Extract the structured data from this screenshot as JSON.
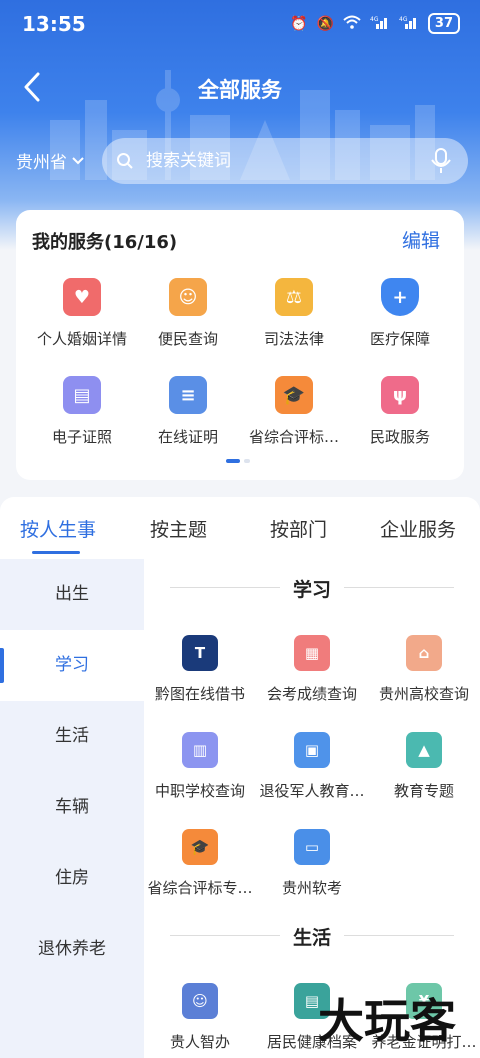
{
  "status": {
    "time": "13:55",
    "battery": "37",
    "icons": [
      "alarm-icon",
      "mute-icon",
      "wifi-icon",
      "signal-4g-icon",
      "signal-4g-icon"
    ]
  },
  "nav": {
    "title": "全部服务"
  },
  "location": {
    "province": "贵州省"
  },
  "search": {
    "placeholder": "搜索关键词"
  },
  "my_services": {
    "title": "我的服务(16/16)",
    "edit": "编辑",
    "items": [
      {
        "label": "个人婚姻详情",
        "icon": "marriage-icon",
        "color": "#f06b6b"
      },
      {
        "label": "便民查询",
        "icon": "house-smile-icon",
        "color": "#f5a54a"
      },
      {
        "label": "司法法律",
        "icon": "gavel-icon",
        "color": "#f4b63e"
      },
      {
        "label": "医疗保障",
        "icon": "shield-plus-icon",
        "color": "#3f86f0"
      },
      {
        "label": "电子证照",
        "icon": "id-card-icon",
        "color": "#8e8ff0"
      },
      {
        "label": "在线证明",
        "icon": "document-icon",
        "color": "#5a8fe6"
      },
      {
        "label": "省综合评标…",
        "icon": "graduate-icon",
        "color": "#f58a3a"
      },
      {
        "label": "民政服务",
        "icon": "hands-people-icon",
        "color": "#ef6b8a"
      }
    ]
  },
  "tabs": [
    "按人生事",
    "按主题",
    "按部门",
    "企业服务"
  ],
  "categories": [
    "出生",
    "学习",
    "生活",
    "车辆",
    "住房",
    "退休养老"
  ],
  "active_category": "学习",
  "sections": [
    {
      "title": "学习",
      "items": [
        {
          "label": "黔图在线借书",
          "icon": "library-logo-icon",
          "color": "#1a3a7a"
        },
        {
          "label": "会考成绩查询",
          "icon": "score-doc-icon",
          "color": "#f07c7c"
        },
        {
          "label": "贵州高校查询",
          "icon": "college-icon",
          "color": "#f2a98a"
        },
        {
          "label": "中职学校查询",
          "icon": "building-icon",
          "color": "#8c95f0"
        },
        {
          "label": "退役军人教育…",
          "icon": "veteran-card-icon",
          "color": "#4f93ea"
        },
        {
          "label": "教育专题",
          "icon": "mortarboard-icon",
          "color": "#4bb9b0"
        },
        {
          "label": "省综合评标专…",
          "icon": "graduate-icon",
          "color": "#f58a3a"
        },
        {
          "label": "贵州软考",
          "icon": "monitor-icon",
          "color": "#4a8fe8"
        }
      ]
    },
    {
      "title": "生活",
      "items": [
        {
          "label": "贵人智办",
          "icon": "avatar-icon",
          "color": "#5b7fd6"
        },
        {
          "label": "居民健康档案",
          "icon": "health-record-icon",
          "color": "#3aa39b"
        },
        {
          "label": "养老金证明打…",
          "icon": "pension-icon",
          "color": "#6dc7a8"
        }
      ]
    }
  ],
  "watermark": "大玩客"
}
